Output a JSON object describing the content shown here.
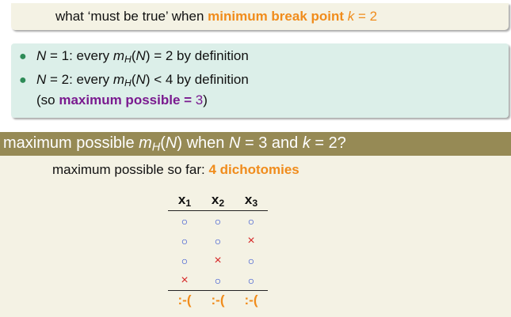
{
  "top_box": {
    "prefix": "what ‘must be true’ when ",
    "highlight": "minimum break point",
    "var": "k",
    "eq": " = 2"
  },
  "block2": {
    "bullet1": {
      "lhs_var": "N",
      "lhs_eq": " = 1: every ",
      "m": "m",
      "h": "H",
      "arg_open": "(",
      "arg": "N",
      "arg_close": ")",
      "rest": " = 2 by definition"
    },
    "bullet2": {
      "lhs_var": "N",
      "lhs_eq": " = 2: every ",
      "m": "m",
      "h": "H",
      "arg_open": "(",
      "arg": "N",
      "arg_close": ")",
      "rest": " < 4 by definition"
    },
    "bullet2_cont": {
      "open": "(so ",
      "bold": "maximum possible = ",
      "num": "3",
      "close": ")"
    }
  },
  "block3": {
    "title": {
      "prefix": "maximum possible ",
      "m": "m",
      "h": "H",
      "arg_open": "(",
      "arg": "N",
      "arg_close": ")",
      "mid": " when ",
      "n_var": "N",
      "n_eq": " = 3 and ",
      "k_var": "k",
      "k_eq": " = 2?"
    },
    "subtitle_prefix": "maximum possible so far: ",
    "subtitle_highlight": "4 dichotomies",
    "table": {
      "headers": [
        {
          "x": "x",
          "sub": "1"
        },
        {
          "x": "x",
          "sub": "2"
        },
        {
          "x": "x",
          "sub": "3"
        }
      ],
      "rows": [
        [
          "○",
          "○",
          "○"
        ],
        [
          "○",
          "○",
          "×"
        ],
        [
          "○",
          "×",
          "○"
        ],
        [
          "×",
          "○",
          "○"
        ]
      ],
      "sad": [
        ":-(",
        ":-(",
        ":-("
      ]
    }
  },
  "colors": {
    "orange": "#f08c1c",
    "purple": "#7a1a8f",
    "circle": "#2344d0",
    "cross": "#d62626",
    "header_bar": "#968a55"
  }
}
